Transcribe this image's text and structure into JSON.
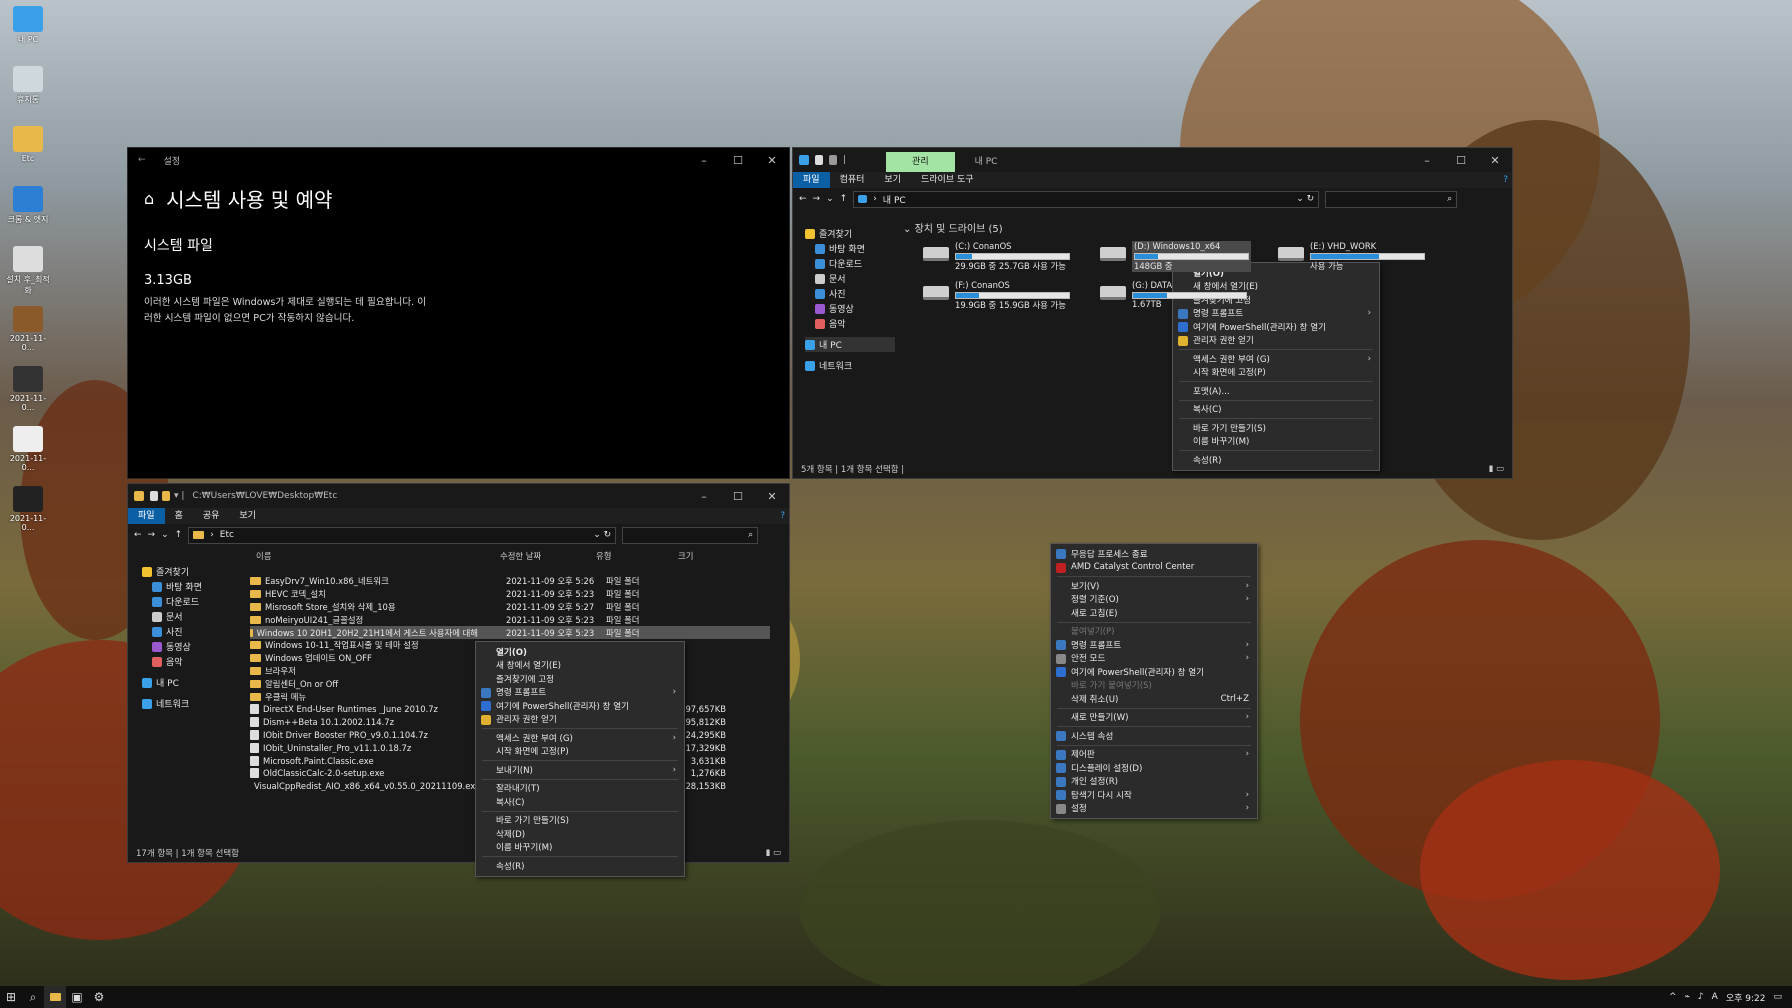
{
  "desktop": {
    "icons": [
      {
        "label": "내 PC",
        "icon": "monitor-icon",
        "color": "#3aa0e8"
      },
      {
        "label": "휴지통",
        "icon": "recycle-bin-icon",
        "color": "#cfd8dc"
      },
      {
        "label": "Etc",
        "icon": "folder-icon",
        "color": "#e8b84a"
      },
      {
        "label": "크롬 & 엣지",
        "icon": "browser-icon",
        "color": "#2d7fd6"
      },
      {
        "label": "설치 후_최적화",
        "icon": "settings-file-icon",
        "color": "#dddddd"
      },
      {
        "label": "2021-11-0...",
        "icon": "image-icon",
        "color": "#8a5a2a"
      },
      {
        "label": "2021-11-0...",
        "icon": "image-icon",
        "color": "#333333"
      },
      {
        "label": "2021-11-0...",
        "icon": "image-icon",
        "color": "#eeeeee"
      },
      {
        "label": "2021-11-0...",
        "icon": "image-icon",
        "color": "#222222"
      }
    ]
  },
  "settings": {
    "title": "설정",
    "heading": "시스템 사용 및 예약",
    "subheading": "시스템 파일",
    "size": "3.13GB",
    "desc1": "이러한 시스템 파일은 Windows가 제대로 실행되는 데 필요합니다. 이",
    "desc2": "러한 시스템 파일이 없으면 PC가 작동하지 않습니다."
  },
  "mypc": {
    "context_tab": "관리",
    "title": "내 PC",
    "tabs": [
      "파일",
      "컴퓨터",
      "보기",
      "드라이브 도구"
    ],
    "address": "내 PC",
    "section": "장치 및 드라이브 (5)",
    "nav": [
      {
        "label": "즐겨찾기",
        "color": "#f2c230"
      },
      {
        "label": "바탕 화면",
        "color": "#3a8fd8"
      },
      {
        "label": "다운로드",
        "color": "#3a8fd8"
      },
      {
        "label": "문서",
        "color": "#cccccc"
      },
      {
        "label": "사진",
        "color": "#3a8fd8"
      },
      {
        "label": "동영상",
        "color": "#9b59d0"
      },
      {
        "label": "음악",
        "color": "#e06060"
      },
      {
        "label": "내 PC",
        "color": "#3aa0e8"
      },
      {
        "label": "네트워크",
        "color": "#3aa0e8"
      }
    ],
    "drives": [
      {
        "name": "(C:) ConanOS",
        "info": "29.9GB 중 25.7GB 사용 가능",
        "used": 0.14
      },
      {
        "name": "(D:) Windows10_x64",
        "info": "148GB 중",
        "used": 0.2
      },
      {
        "name": "(E:) VHD_WORK",
        "info": "사용 가능",
        "used": 0.6
      },
      {
        "name": "(F:) ConanOS",
        "info": "19.9GB 중 15.9GB 사용 가능",
        "used": 0.2
      },
      {
        "name": "(G:) DATA",
        "info": "1.67TB",
        "used": 0.3
      }
    ],
    "status": "5개 항목   |   1개 항목 선택함   |"
  },
  "drive_menu": [
    {
      "label": "열기(O)",
      "bold": true
    },
    {
      "label": "새 창에서 열기(E)"
    },
    {
      "label": "즐겨찾기에 고정"
    },
    {
      "label": "명령 프롬프트",
      "icon": "cmd-icon",
      "sub": true
    },
    {
      "label": "여기에 PowerShell(관리자) 창 열기",
      "icon": "powershell-icon"
    },
    {
      "label": "관리자 권한 얻기",
      "icon": "shield-icon"
    },
    {
      "sep": true
    },
    {
      "label": "액세스 권한 부여 (G)",
      "sub": true
    },
    {
      "label": "시작 화면에 고정(P)"
    },
    {
      "sep": true
    },
    {
      "label": "포맷(A)..."
    },
    {
      "sep": true
    },
    {
      "label": "복사(C)"
    },
    {
      "sep": true
    },
    {
      "label": "바로 가기 만들기(S)"
    },
    {
      "label": "이름 바꾸기(M)"
    },
    {
      "sep": true
    },
    {
      "label": "속성(R)"
    }
  ],
  "etc": {
    "title": "C:₩Users₩LOVE₩Desktop₩Etc",
    "tabs": [
      "파일",
      "홈",
      "공유",
      "보기"
    ],
    "address": "Etc",
    "columns": [
      "이름",
      "수정한 날짜",
      "유형",
      "크기"
    ],
    "nav": [
      {
        "label": "즐겨찾기",
        "color": "#f2c230"
      },
      {
        "label": "바탕 화면",
        "color": "#3a8fd8"
      },
      {
        "label": "다운로드",
        "color": "#3a8fd8"
      },
      {
        "label": "문서",
        "color": "#cccccc"
      },
      {
        "label": "사진",
        "color": "#3a8fd8"
      },
      {
        "label": "동영상",
        "color": "#9b59d0"
      },
      {
        "label": "음악",
        "color": "#e06060"
      },
      {
        "label": "내 PC",
        "color": "#3aa0e8"
      },
      {
        "label": "네트워크",
        "color": "#3aa0e8"
      }
    ],
    "files": [
      {
        "name": "EasyDrv7_Win10.x86_네트워크",
        "date": "2021-11-09 오후 5:26",
        "type": "파일 폴더",
        "size": "",
        "kind": "folder"
      },
      {
        "name": "HEVC 코덱_설치",
        "date": "2021-11-09 오후 5:23",
        "type": "파일 폴더",
        "size": "",
        "kind": "folder"
      },
      {
        "name": "Misrosoft Store_설치와 삭제_10용",
        "date": "2021-11-09 오후 5:27",
        "type": "파일 폴더",
        "size": "",
        "kind": "folder"
      },
      {
        "name": "noMeiryoUI241_글꼴설정",
        "date": "2021-11-09 오후 5:23",
        "type": "파일 폴더",
        "size": "",
        "kind": "folder"
      },
      {
        "name": "Windows 10 20H1_20H2_21H1에서 게스트 사용자에 대해",
        "date": "2021-11-09 오후 5:23",
        "type": "파일 폴더",
        "size": "",
        "kind": "folder",
        "selected": true
      },
      {
        "name": "Windows 10-11_작업표시줄 및 테마 설정",
        "date": "",
        "type": "",
        "size": "",
        "kind": "folder"
      },
      {
        "name": "Windows 업데이트 ON_OFF",
        "date": "",
        "type": "",
        "size": "",
        "kind": "folder"
      },
      {
        "name": "브라우저",
        "date": "",
        "type": "",
        "size": "",
        "kind": "folder"
      },
      {
        "name": "알림센터_On or Off",
        "date": "",
        "type": "",
        "size": "",
        "kind": "folder"
      },
      {
        "name": "우클릭 메뉴",
        "date": "",
        "type": "",
        "size": "",
        "kind": "folder"
      },
      {
        "name": "DirectX End-User Runtimes _June 2010.7z",
        "date": "",
        "type": "",
        "size": "97,657KB",
        "kind": "file"
      },
      {
        "name": "Dism++Beta 10.1.2002.114.7z",
        "date": "",
        "type": "",
        "size": "95,812KB",
        "kind": "file"
      },
      {
        "name": "IObit Driver Booster PRO_v9.0.1.104.7z",
        "date": "",
        "type": "",
        "size": "24,295KB",
        "kind": "file"
      },
      {
        "name": "IObit_Uninstaller_Pro_v11.1.0.18.7z",
        "date": "",
        "type": "",
        "size": "17,329KB",
        "kind": "file"
      },
      {
        "name": "Microsoft.Paint.Classic.exe",
        "date": "",
        "type": "",
        "size": "3,631KB",
        "kind": "file"
      },
      {
        "name": "OldClassicCalc-2.0-setup.exe",
        "date": "",
        "type": "",
        "size": "1,276KB",
        "kind": "file"
      },
      {
        "name": "VisualCppRedist_AIO_x86_x64_v0.55.0_20211109.exe",
        "date": "",
        "type": "",
        "size": "28,153KB",
        "kind": "file"
      }
    ],
    "status": "17개 항목   |   1개 항목 선택함"
  },
  "folder_menu": [
    {
      "label": "열기(O)",
      "bold": true
    },
    {
      "label": "새 창에서 열기(E)"
    },
    {
      "label": "즐겨찾기에 고정"
    },
    {
      "label": "명령 프롬프트",
      "icon": "cmd-icon",
      "sub": true
    },
    {
      "label": "여기에 PowerShell(관리자) 창 열기",
      "icon": "powershell-icon"
    },
    {
      "label": "관리자 권한 얻기",
      "icon": "shield-icon"
    },
    {
      "sep": true
    },
    {
      "label": "액세스 권한 부여 (G)",
      "sub": true
    },
    {
      "label": "시작 화면에 고정(P)"
    },
    {
      "sep": true
    },
    {
      "label": "보내기(N)",
      "sub": true
    },
    {
      "sep": true
    },
    {
      "label": "잘라내기(T)"
    },
    {
      "label": "복사(C)"
    },
    {
      "sep": true
    },
    {
      "label": "바로 가기 만들기(S)"
    },
    {
      "label": "삭제(D)"
    },
    {
      "label": "이름 바꾸기(M)"
    },
    {
      "sep": true
    },
    {
      "label": "속성(R)"
    }
  ],
  "desktop_menu": [
    {
      "label": "무응답 프로세스 종료",
      "icon": "process-icon"
    },
    {
      "label": "AMD Catalyst Control Center",
      "icon": "amd-icon"
    },
    {
      "sep": true
    },
    {
      "label": "보기(V)",
      "sub": true
    },
    {
      "label": "정렬 기준(O)",
      "sub": true
    },
    {
      "label": "새로 고침(E)"
    },
    {
      "sep": true
    },
    {
      "label": "붙여넣기(P)",
      "disabled": true
    },
    {
      "label": "명령 프롬프트",
      "icon": "cmd-icon",
      "sub": true
    },
    {
      "label": "안전 모드",
      "icon": "gear-icon",
      "sub": true
    },
    {
      "label": "여기에 PowerShell(관리자) 창 열기",
      "icon": "powershell-icon"
    },
    {
      "label": "바로 가기 붙여넣기(S)",
      "disabled": true
    },
    {
      "label": "삭제 취소(U)",
      "shortcut": "Ctrl+Z"
    },
    {
      "sep": true
    },
    {
      "label": "새로 만들기(W)",
      "sub": true
    },
    {
      "sep": true
    },
    {
      "label": "시스템 속성",
      "icon": "monitor-icon"
    },
    {
      "sep": true
    },
    {
      "label": "제어판",
      "icon": "control-panel-icon",
      "sub": true
    },
    {
      "label": "디스플레이 설정(D)",
      "icon": "display-icon"
    },
    {
      "label": "개인 설정(R)",
      "icon": "personalize-icon"
    },
    {
      "label": "탐색기 다시 시작",
      "icon": "folder-icon",
      "sub": true
    },
    {
      "label": "설정",
      "icon": "gear-icon",
      "sub": true
    }
  ],
  "taskbar": {
    "lang": "A",
    "clock": "오후 9:22"
  }
}
